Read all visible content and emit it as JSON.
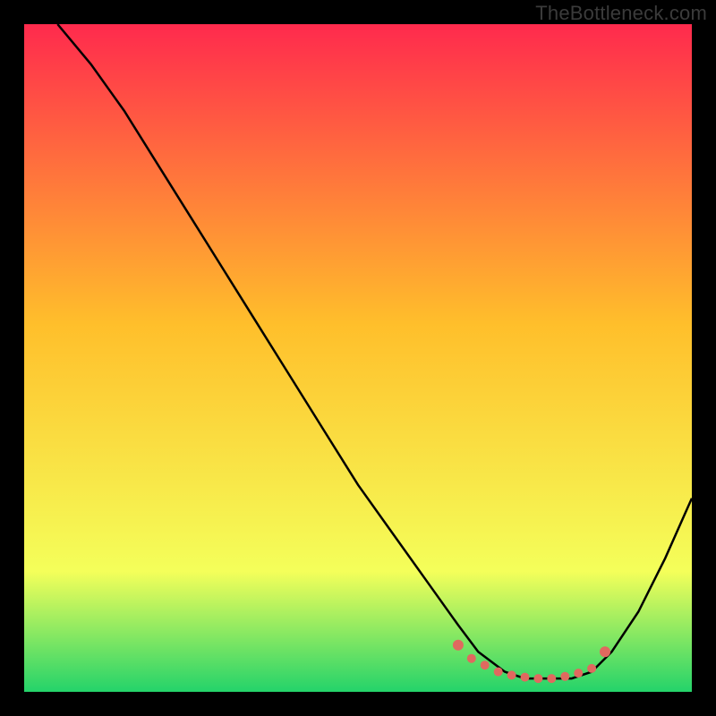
{
  "watermark": "TheBottleneck.com",
  "chart_data": {
    "type": "line",
    "title": "",
    "xlabel": "",
    "ylabel": "",
    "xlim": [
      0,
      100
    ],
    "ylim": [
      0,
      100
    ],
    "grid": false,
    "legend": false,
    "background_gradient": {
      "top": "#ff2a4d",
      "mid": "#ffbf2b",
      "lower": "#f4ff5a",
      "bottom": "#24d36a"
    },
    "series": [
      {
        "name": "curve",
        "color": "#000000",
        "x": [
          5,
          10,
          15,
          20,
          25,
          30,
          35,
          40,
          45,
          50,
          55,
          60,
          65,
          68,
          72,
          75,
          78,
          80,
          82,
          85,
          88,
          92,
          96,
          100
        ],
        "y": [
          100,
          94,
          87,
          79,
          71,
          63,
          55,
          47,
          39,
          31,
          24,
          17,
          10,
          6,
          3,
          2,
          2,
          2,
          2,
          3,
          6,
          12,
          20,
          29
        ]
      }
    ],
    "markers": {
      "name": "bottom-points",
      "color": "#e0695f",
      "x": [
        65,
        67,
        69,
        71,
        73,
        75,
        77,
        79,
        81,
        83,
        85,
        87
      ],
      "y": [
        7,
        5,
        4,
        3,
        2.5,
        2.2,
        2,
        2,
        2.3,
        2.8,
        3.5,
        6
      ]
    }
  }
}
